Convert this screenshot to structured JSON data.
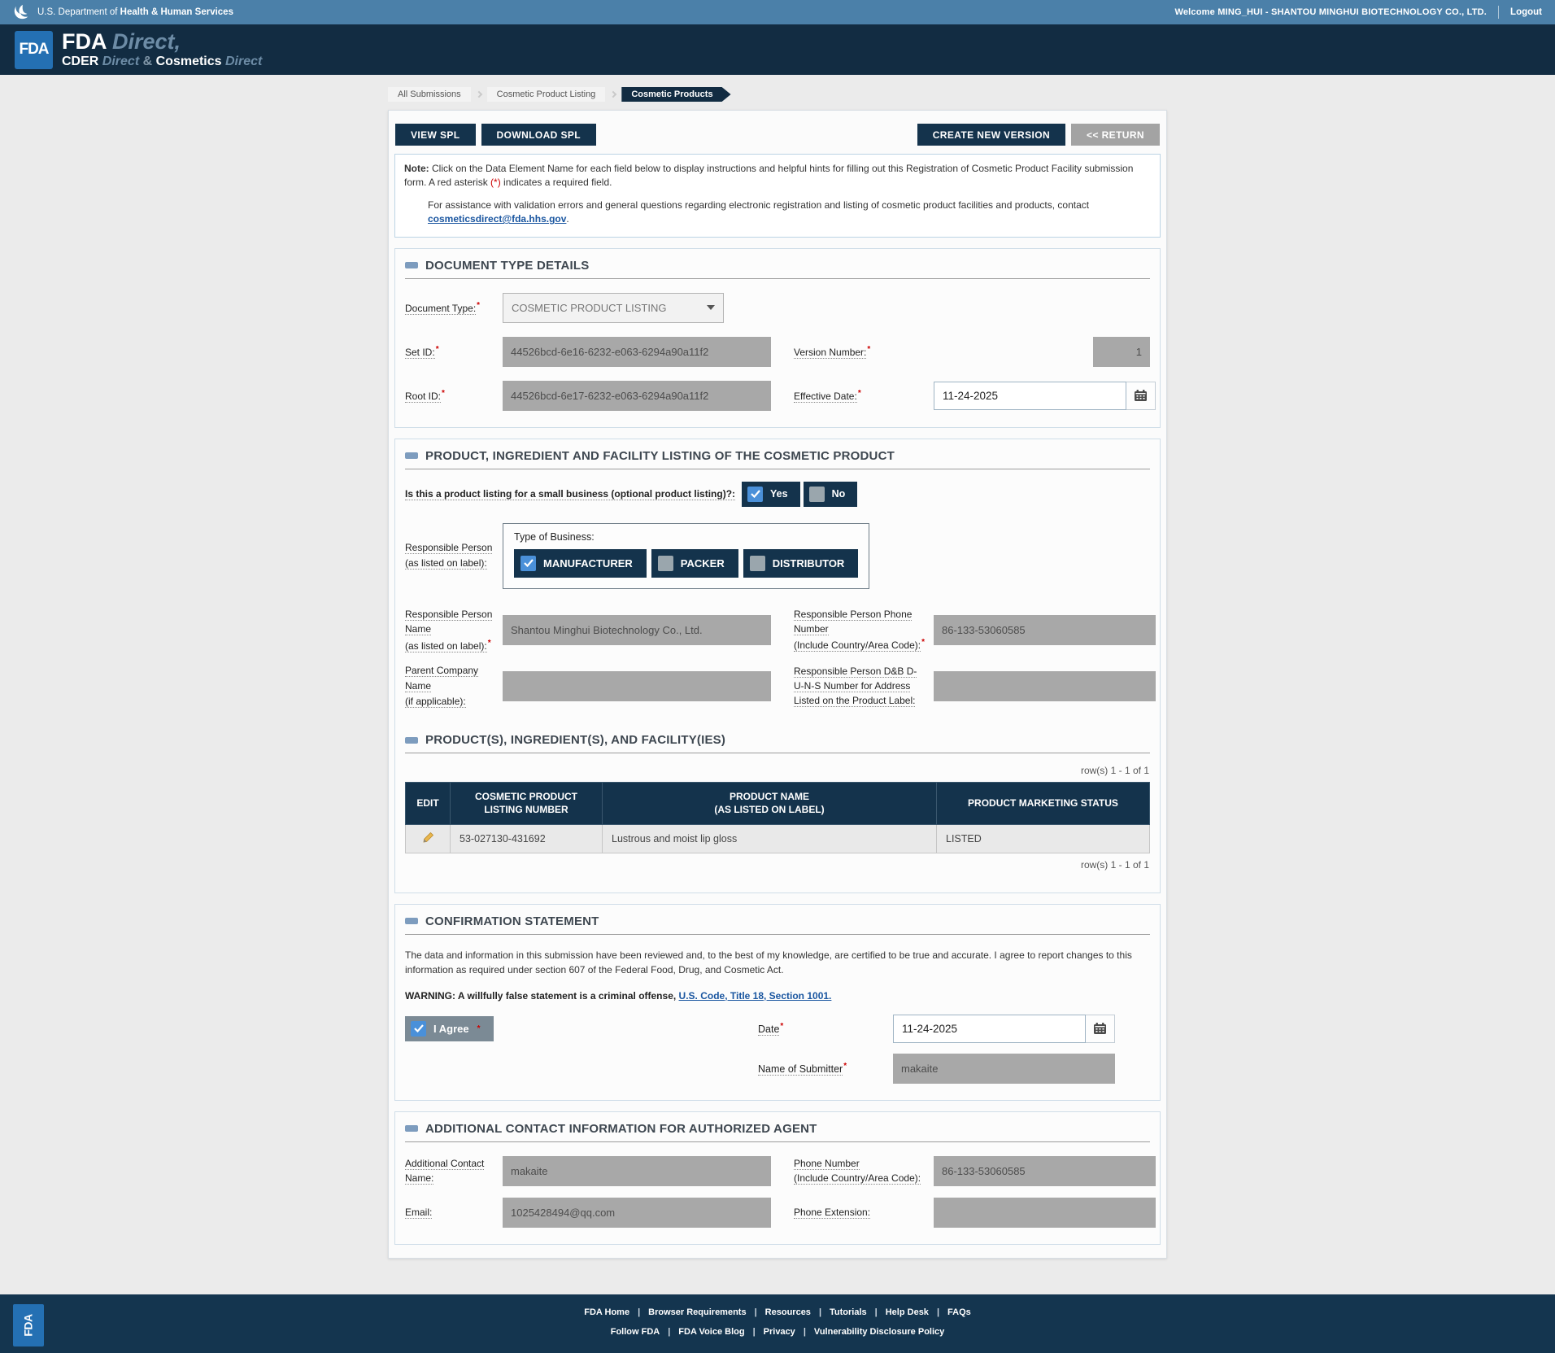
{
  "required_marker": "*",
  "colors": {
    "topbar_blue": "#4b80a9",
    "header_navy": "#122c42",
    "button_navy": "#14334c",
    "checkbox_blue": "#4a90d9",
    "readonly_gray": "#a8a8a8",
    "link_blue": "#1a56a0",
    "required_red": "#cc0000",
    "fda_logo_blue": "#2470b3"
  },
  "topbar": {
    "dept_prefix": "U.S. Department of",
    "dept_bold": "Health & Human Services",
    "welcome": "Welcome MING_HUI - SHANTOU MINGHUI BIOTECHNOLOGY CO., LTD.",
    "logout": "Logout"
  },
  "header": {
    "logo_text": "FDA",
    "brand_main": "FDA",
    "brand_main_suffix": "Direct",
    "brand_comma": ",",
    "sub_cder": "CDER",
    "sub_direct1": "Direct",
    "sub_amp": "&",
    "sub_cosmetics": "Cosmetics",
    "sub_direct2": "Direct"
  },
  "breadcrumb": {
    "items": [
      {
        "label": "All Submissions"
      },
      {
        "label": "Cosmetic Product Listing"
      },
      {
        "label": "Cosmetic Products"
      }
    ]
  },
  "toolbar": {
    "view_spl": "VIEW SPL",
    "download_spl": "DOWNLOAD SPL",
    "create_new_version": "CREATE NEW VERSION",
    "return": "<< RETURN"
  },
  "note": {
    "bold": "Note:",
    "part1": " Click on the Data Element Name for each field below to display instructions and helpful hints for filling out this Registration of Cosmetic Product Facility submission form. A red asterisk ",
    "asterisk": "(*)",
    "part2": " indicates a required field.",
    "assist_text": "For assistance with validation errors and general questions regarding electronic registration and listing of cosmetic product facilities and products, contact ",
    "assist_email": "cosmeticsdirect@fda.hhs.gov",
    "assist_period": "."
  },
  "doc_type": {
    "title": "DOCUMENT TYPE DETAILS",
    "document_type_label": "Document Type:",
    "document_type_value": "COSMETIC PRODUCT LISTING",
    "set_id_label": "Set ID:",
    "set_id_value": "44526bcd-6e16-6232-e063-6294a90a11f2",
    "version_label": "Version Number:",
    "version_value": "1",
    "root_id_label": "Root ID:",
    "root_id_value": "44526bcd-6e17-6232-e063-6294a90a11f2",
    "effective_date_label": "Effective Date:",
    "effective_date_value": "11-24-2025"
  },
  "product_section": {
    "title": "PRODUCT, INGREDIENT AND FACILITY LISTING OF THE COSMETIC PRODUCT",
    "small_business_label": "Is this a product listing for a small business (optional product listing)?:",
    "yes_label": "Yes",
    "no_label": "No",
    "rp_label_line1": "Responsible Person",
    "rp_label_line2": "(as listed on label):",
    "type_of_business_label": "Type of Business:",
    "business_types": [
      "MANUFACTURER",
      "PACKER",
      "DISTRIBUTOR"
    ],
    "rp_name_label_line1": "Responsible Person Name",
    "rp_name_label_line2": "(as listed on label):",
    "rp_name_value": "Shantou Minghui Biotechnology Co., Ltd.",
    "rp_phone_label_line1": "Responsible Person Phone Number",
    "rp_phone_label_line2": "(Include Country/Area Code):",
    "rp_phone_value": "86-133-53060585",
    "parent_company_label_line1": "Parent Company Name",
    "parent_company_label_line2": "(if applicable):",
    "parent_company_value": "",
    "duns_label": "Responsible Person D&B D-U-N-S Number for Address Listed on the Product Label:",
    "duns_value": ""
  },
  "products_table": {
    "title": "PRODUCT(S), INGREDIENT(S), AND FACILITY(IES)",
    "row_count_text": "row(s) 1 - 1 of 1",
    "headers": {
      "edit": "EDIT",
      "listing_number_line1": "COSMETIC PRODUCT",
      "listing_number_line2": "LISTING NUMBER",
      "product_name_line1": "PRODUCT NAME",
      "product_name_line2": "(AS LISTED ON LABEL)",
      "status": "PRODUCT MARKETING STATUS"
    },
    "rows": [
      {
        "listing_number": "53-027130-431692",
        "product_name": "Lustrous and moist lip gloss",
        "status": "LISTED"
      }
    ]
  },
  "confirmation": {
    "title": "CONFIRMATION STATEMENT",
    "statement": "The data and information in this submission have been reviewed and, to the best of my knowledge, are certified to be true and accurate. I agree to report changes to this information as required under section 607 of the Federal Food, Drug, and Cosmetic Act.",
    "warning_bold": "WARNING:",
    "warning_text": " A willfully false statement is a criminal offense, ",
    "warning_link": "U.S. Code, Title 18, Section 1001.",
    "i_agree_label": "I Agree",
    "date_label": "Date",
    "date_value": "11-24-2025",
    "submitter_label": "Name of Submitter",
    "submitter_value": "makaite"
  },
  "additional_contact": {
    "title": "ADDITIONAL CONTACT INFORMATION FOR AUTHORIZED AGENT",
    "name_label": "Additional Contact Name:",
    "name_value": "makaite",
    "phone_label_line1": "Phone Number",
    "phone_label_line2": "(Include Country/Area Code):",
    "phone_value": "86-133-53060585",
    "email_label": "Email:",
    "email_value": "1025428494@qq.com",
    "ext_label": "Phone Extension:",
    "ext_value": ""
  },
  "footer": {
    "logo_text": "FDA",
    "row1": [
      "FDA Home",
      "Browser Requirements",
      "Resources",
      "Tutorials",
      "Help Desk",
      "FAQs"
    ],
    "row2": [
      "Follow FDA",
      "FDA Voice Blog",
      "Privacy",
      "Vulnerability Disclosure Policy"
    ]
  }
}
